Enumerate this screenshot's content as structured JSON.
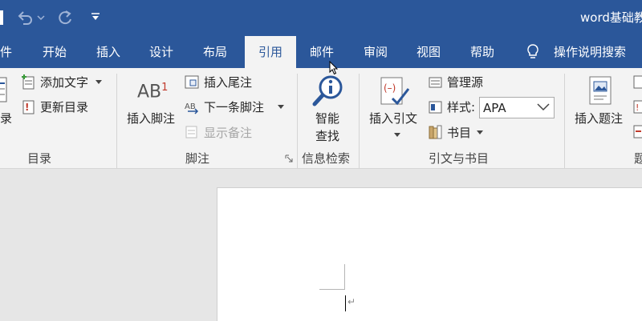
{
  "window": {
    "title": "word基础教"
  },
  "tabs": [
    "件",
    "开始",
    "插入",
    "设计",
    "布局",
    "引用",
    "邮件",
    "审阅",
    "视图",
    "帮助"
  ],
  "tell_me": "操作说明搜索",
  "ribbon": {
    "toc": {
      "add_text": "添加文字",
      "update_toc": "更新目录",
      "toc_fragment": "录",
      "group": "目录"
    },
    "footnotes": {
      "insert_footnote": "插入脚注",
      "insert_endnote": "插入尾注",
      "next_footnote": "下一条脚注",
      "show_notes": "显示备注",
      "group": "脚注",
      "icon_ab": "AB",
      "icon_sup": "1"
    },
    "research": {
      "smart_lookup_1": "智能",
      "smart_lookup_2": "查找",
      "group": "信息检索"
    },
    "citations": {
      "insert_citation": "插入引文",
      "manage_sources": "管理源",
      "style_label": "样式:",
      "style_value": "APA",
      "bibliography": "书目",
      "group": "引文与书目"
    },
    "captions": {
      "insert_caption": "插入题注",
      "group_fragment": "题"
    }
  },
  "document": {
    "paragraph_mark": "↵"
  },
  "colors": {
    "accent": "#2b579a",
    "ribbon_bg": "#f3f3f3"
  }
}
